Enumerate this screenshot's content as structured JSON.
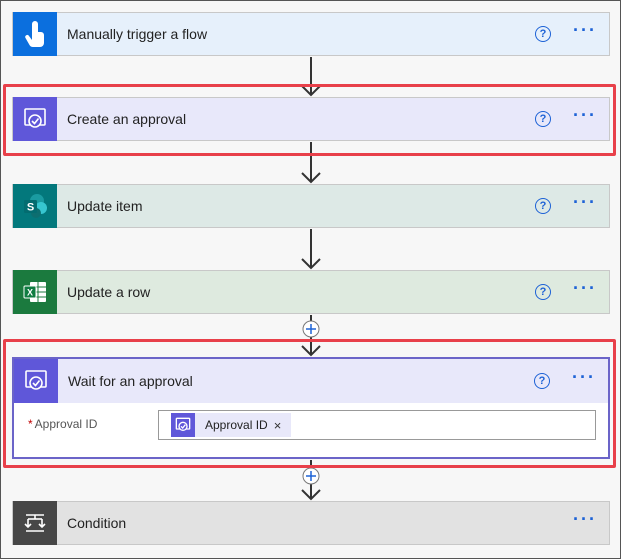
{
  "steps": {
    "trigger": {
      "title": "Manually trigger a flow",
      "icon": "touch-hand-icon"
    },
    "create_approval": {
      "title": "Create an approval",
      "icon": "approval-icon"
    },
    "update_item": {
      "title": "Update item",
      "icon": "sharepoint-icon"
    },
    "update_row": {
      "title": "Update a row",
      "icon": "excel-icon"
    },
    "wait_approval": {
      "title": "Wait for an approval",
      "icon": "approval-icon",
      "field_label": "Approval ID",
      "required_marker": "*",
      "token_label": "Approval ID",
      "token_remove": "×"
    },
    "condition": {
      "title": "Condition",
      "icon": "condition-icon"
    }
  },
  "controls": {
    "help": "?",
    "more": "···",
    "add": "+"
  },
  "colors": {
    "accent": "#1d62d6",
    "highlight": "#e8404a",
    "approval": "#5f57d9",
    "trigger": "#0b6fde",
    "sharepoint": "#03787c",
    "excel": "#1b7a3e",
    "condition": "#474747"
  }
}
